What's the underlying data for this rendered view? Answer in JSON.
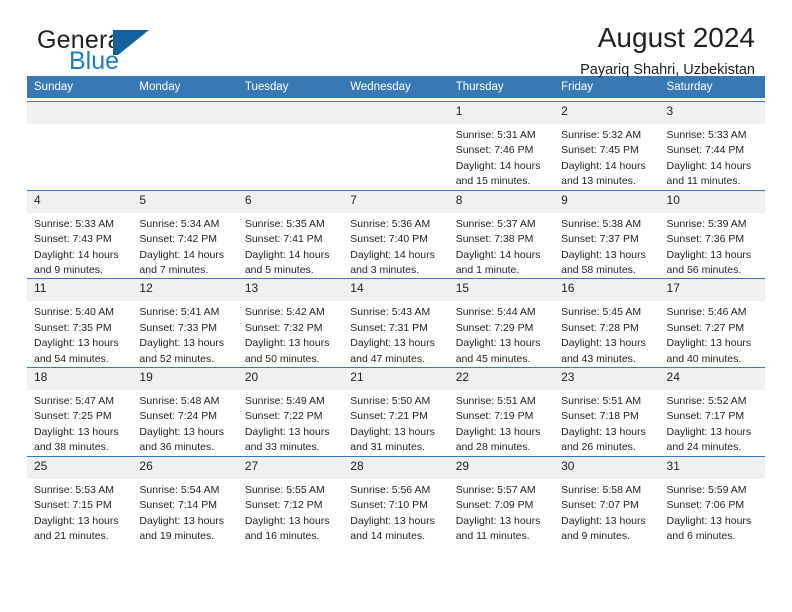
{
  "brand": {
    "name_part1": "General",
    "name_part2": "Blue",
    "logo_icon": "triangle-flag-icon"
  },
  "header": {
    "month_title": "August 2024",
    "location": "Payariq Shahri, Uzbekistan"
  },
  "calendar": {
    "weekday_headers": [
      "Sunday",
      "Monday",
      "Tuesday",
      "Wednesday",
      "Thursday",
      "Friday",
      "Saturday"
    ],
    "accent_color": "#3878b4",
    "daynum_band_color": "#f0f0f0",
    "weeks": [
      [
        {
          "day": "",
          "lines": []
        },
        {
          "day": "",
          "lines": []
        },
        {
          "day": "",
          "lines": []
        },
        {
          "day": "",
          "lines": []
        },
        {
          "day": "1",
          "lines": [
            "Sunrise: 5:31 AM",
            "Sunset: 7:46 PM",
            "Daylight: 14 hours",
            "and 15 minutes."
          ]
        },
        {
          "day": "2",
          "lines": [
            "Sunrise: 5:32 AM",
            "Sunset: 7:45 PM",
            "Daylight: 14 hours",
            "and 13 minutes."
          ]
        },
        {
          "day": "3",
          "lines": [
            "Sunrise: 5:33 AM",
            "Sunset: 7:44 PM",
            "Daylight: 14 hours",
            "and 11 minutes."
          ]
        }
      ],
      [
        {
          "day": "4",
          "lines": [
            "Sunrise: 5:33 AM",
            "Sunset: 7:43 PM",
            "Daylight: 14 hours",
            "and 9 minutes."
          ]
        },
        {
          "day": "5",
          "lines": [
            "Sunrise: 5:34 AM",
            "Sunset: 7:42 PM",
            "Daylight: 14 hours",
            "and 7 minutes."
          ]
        },
        {
          "day": "6",
          "lines": [
            "Sunrise: 5:35 AM",
            "Sunset: 7:41 PM",
            "Daylight: 14 hours",
            "and 5 minutes."
          ]
        },
        {
          "day": "7",
          "lines": [
            "Sunrise: 5:36 AM",
            "Sunset: 7:40 PM",
            "Daylight: 14 hours",
            "and 3 minutes."
          ]
        },
        {
          "day": "8",
          "lines": [
            "Sunrise: 5:37 AM",
            "Sunset: 7:38 PM",
            "Daylight: 14 hours",
            "and 1 minute."
          ]
        },
        {
          "day": "9",
          "lines": [
            "Sunrise: 5:38 AM",
            "Sunset: 7:37 PM",
            "Daylight: 13 hours",
            "and 58 minutes."
          ]
        },
        {
          "day": "10",
          "lines": [
            "Sunrise: 5:39 AM",
            "Sunset: 7:36 PM",
            "Daylight: 13 hours",
            "and 56 minutes."
          ]
        }
      ],
      [
        {
          "day": "11",
          "lines": [
            "Sunrise: 5:40 AM",
            "Sunset: 7:35 PM",
            "Daylight: 13 hours",
            "and 54 minutes."
          ]
        },
        {
          "day": "12",
          "lines": [
            "Sunrise: 5:41 AM",
            "Sunset: 7:33 PM",
            "Daylight: 13 hours",
            "and 52 minutes."
          ]
        },
        {
          "day": "13",
          "lines": [
            "Sunrise: 5:42 AM",
            "Sunset: 7:32 PM",
            "Daylight: 13 hours",
            "and 50 minutes."
          ]
        },
        {
          "day": "14",
          "lines": [
            "Sunrise: 5:43 AM",
            "Sunset: 7:31 PM",
            "Daylight: 13 hours",
            "and 47 minutes."
          ]
        },
        {
          "day": "15",
          "lines": [
            "Sunrise: 5:44 AM",
            "Sunset: 7:29 PM",
            "Daylight: 13 hours",
            "and 45 minutes."
          ]
        },
        {
          "day": "16",
          "lines": [
            "Sunrise: 5:45 AM",
            "Sunset: 7:28 PM",
            "Daylight: 13 hours",
            "and 43 minutes."
          ]
        },
        {
          "day": "17",
          "lines": [
            "Sunrise: 5:46 AM",
            "Sunset: 7:27 PM",
            "Daylight: 13 hours",
            "and 40 minutes."
          ]
        }
      ],
      [
        {
          "day": "18",
          "lines": [
            "Sunrise: 5:47 AM",
            "Sunset: 7:25 PM",
            "Daylight: 13 hours",
            "and 38 minutes."
          ]
        },
        {
          "day": "19",
          "lines": [
            "Sunrise: 5:48 AM",
            "Sunset: 7:24 PM",
            "Daylight: 13 hours",
            "and 36 minutes."
          ]
        },
        {
          "day": "20",
          "lines": [
            "Sunrise: 5:49 AM",
            "Sunset: 7:22 PM",
            "Daylight: 13 hours",
            "and 33 minutes."
          ]
        },
        {
          "day": "21",
          "lines": [
            "Sunrise: 5:50 AM",
            "Sunset: 7:21 PM",
            "Daylight: 13 hours",
            "and 31 minutes."
          ]
        },
        {
          "day": "22",
          "lines": [
            "Sunrise: 5:51 AM",
            "Sunset: 7:19 PM",
            "Daylight: 13 hours",
            "and 28 minutes."
          ]
        },
        {
          "day": "23",
          "lines": [
            "Sunrise: 5:51 AM",
            "Sunset: 7:18 PM",
            "Daylight: 13 hours",
            "and 26 minutes."
          ]
        },
        {
          "day": "24",
          "lines": [
            "Sunrise: 5:52 AM",
            "Sunset: 7:17 PM",
            "Daylight: 13 hours",
            "and 24 minutes."
          ]
        }
      ],
      [
        {
          "day": "25",
          "lines": [
            "Sunrise: 5:53 AM",
            "Sunset: 7:15 PM",
            "Daylight: 13 hours",
            "and 21 minutes."
          ]
        },
        {
          "day": "26",
          "lines": [
            "Sunrise: 5:54 AM",
            "Sunset: 7:14 PM",
            "Daylight: 13 hours",
            "and 19 minutes."
          ]
        },
        {
          "day": "27",
          "lines": [
            "Sunrise: 5:55 AM",
            "Sunset: 7:12 PM",
            "Daylight: 13 hours",
            "and 16 minutes."
          ]
        },
        {
          "day": "28",
          "lines": [
            "Sunrise: 5:56 AM",
            "Sunset: 7:10 PM",
            "Daylight: 13 hours",
            "and 14 minutes."
          ]
        },
        {
          "day": "29",
          "lines": [
            "Sunrise: 5:57 AM",
            "Sunset: 7:09 PM",
            "Daylight: 13 hours",
            "and 11 minutes."
          ]
        },
        {
          "day": "30",
          "lines": [
            "Sunrise: 5:58 AM",
            "Sunset: 7:07 PM",
            "Daylight: 13 hours",
            "and 9 minutes."
          ]
        },
        {
          "day": "31",
          "lines": [
            "Sunrise: 5:59 AM",
            "Sunset: 7:06 PM",
            "Daylight: 13 hours",
            "and 6 minutes."
          ]
        }
      ]
    ]
  }
}
